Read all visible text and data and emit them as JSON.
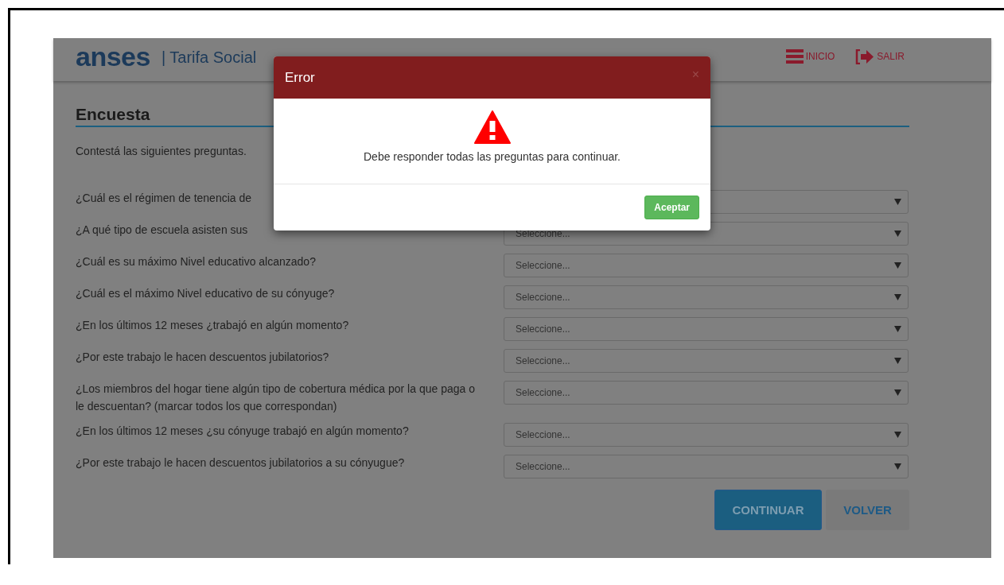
{
  "header": {
    "logo": "anses",
    "subtitle": "| Tarifa Social",
    "nav": [
      {
        "label": "INICIO",
        "kind": "menu"
      },
      {
        "label": "SALIR",
        "kind": "exit"
      }
    ]
  },
  "page": {
    "title": "Encuesta",
    "intro": "Contestá las siguientes preguntas.",
    "questions": [
      {
        "label": "¿Cuál es el régimen de tenencia de"
      },
      {
        "label": "¿A qué tipo de escuela asisten sus",
        "placeholder": "Seleccione..."
      },
      {
        "label": "¿Cuál es su máximo Nivel educativo alcanzado?",
        "placeholder": "Seleccione..."
      },
      {
        "label": "¿Cuál es el máximo Nivel educativo de su cónyuge?",
        "placeholder": "Seleccione..."
      },
      {
        "label": "¿En los últimos 12 meses ¿trabajó en algún momento?",
        "placeholder": "Seleccione..."
      },
      {
        "label": "¿Por este trabajo le hacen descuentos jubilatorios?",
        "placeholder": "Seleccione..."
      },
      {
        "label": "¿Los miembros del hogar tiene algún tipo de cobertura médica por la que paga o le descuentan? (marcar todos los que correspondan)",
        "placeholder": "Seleccione..."
      },
      {
        "label": "¿En los últimos 12 meses ¿su cónyuge trabajó en algún momento?",
        "placeholder": "Seleccione..."
      },
      {
        "label": "¿Por este trabajo le hacen descuentos jubilatorios a su cónyugue?",
        "placeholder": "Seleccione..."
      }
    ],
    "buttons": [
      {
        "label": "CONTINUAR",
        "kind": "primary"
      },
      {
        "label": "VOLVER",
        "kind": "secondary"
      }
    ]
  },
  "dialog": {
    "title": "Error",
    "close": "×",
    "message": "Debe responder todas las preguntas para continuar.",
    "buttons": [
      "Aceptar"
    ]
  }
}
